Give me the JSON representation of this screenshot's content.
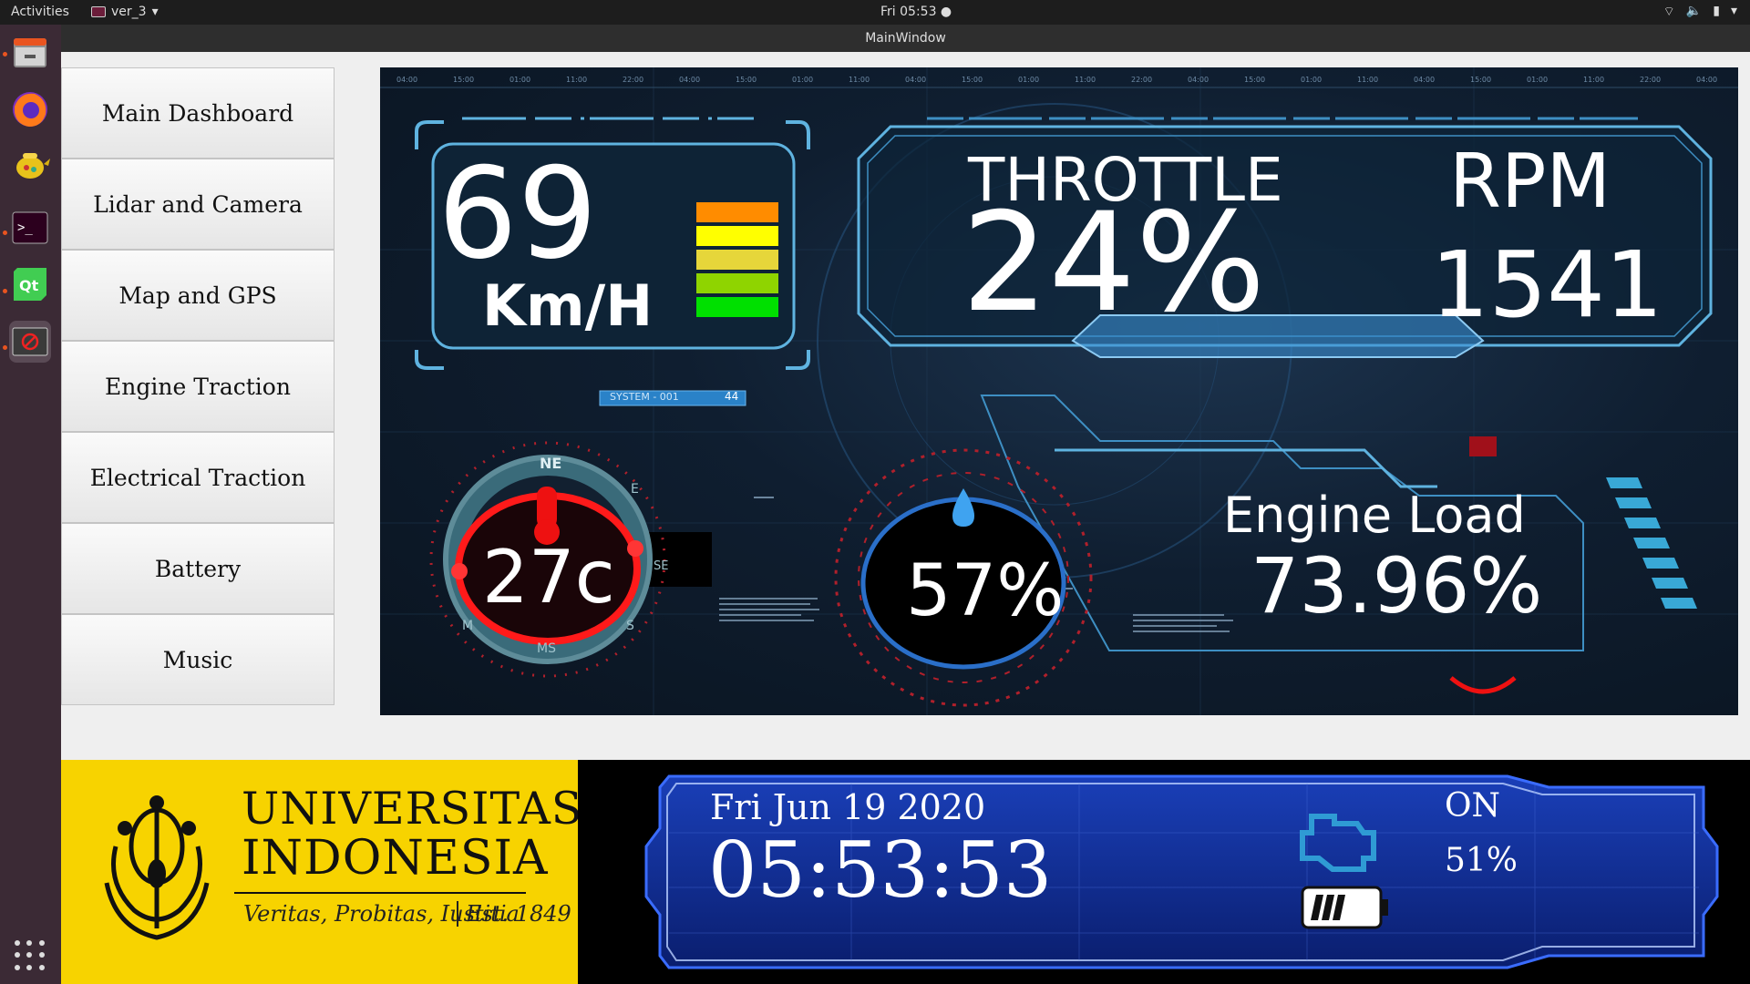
{
  "topbar": {
    "activities": "Activities",
    "app_name": "ver_3",
    "clock": "Fri 05:53 ●"
  },
  "window": {
    "title": "MainWindow"
  },
  "nav": {
    "items": [
      {
        "label": "Main Dashboard"
      },
      {
        "label": "Lidar and Camera"
      },
      {
        "label": "Map and GPS"
      },
      {
        "label": "Engine Traction"
      },
      {
        "label": "Electrical Traction"
      },
      {
        "label": "Battery"
      },
      {
        "label": "Music"
      }
    ]
  },
  "dashboard": {
    "speed_value": "69",
    "speed_unit": "Km/H",
    "system_label": "SYSTEM - 001",
    "system_value": "44",
    "throttle_label": "THROTTLE",
    "throttle_value": "24%",
    "rpm_label": "RPM",
    "rpm_value": "1541",
    "temperature": "27c",
    "humidity": "57%",
    "engine_load_label": "Engine Load",
    "engine_load_value": "73.96%",
    "compass_ne": "NE",
    "compass_e": "E",
    "compass_se": "SE",
    "compass_s": "S",
    "compass_ms": "MS",
    "compass_m": "M",
    "speed_bar_colors": [
      "#ff8c00",
      "#ffff00",
      "#e6d63a",
      "#8fd400",
      "#00e000"
    ],
    "timeline": [
      "04:00",
      "15:00",
      "01:00",
      "11:00",
      "22:00",
      "04:00",
      "15:00",
      "01:00",
      "11:00",
      "04:00",
      "15:00",
      "01:00",
      "11:00",
      "22:00",
      "04:00",
      "15:00",
      "01:00",
      "11:00",
      "04:00",
      "15:00",
      "01:00",
      "11:00",
      "22:00",
      "04:00"
    ]
  },
  "logo": {
    "line1": "UNIVERSITAS",
    "line2": "INDONESIA",
    "motto": "Veritas, Probitas, Iustitia",
    "est": "Est. 1849"
  },
  "status": {
    "date": "Fri Jun 19 2020",
    "time": "05:53:53",
    "engine_state": "ON",
    "battery": "51%",
    "battery_level": 0.51,
    "engine_icon": "engine-check-icon",
    "battery_icon": "battery-icon"
  }
}
